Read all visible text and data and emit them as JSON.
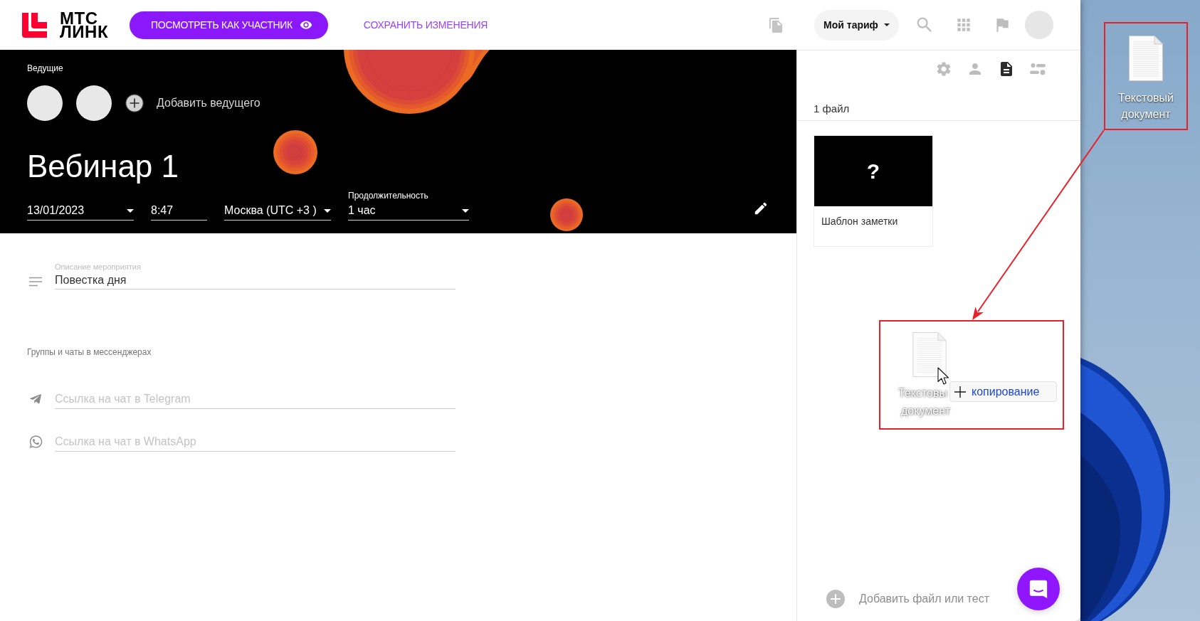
{
  "header": {
    "logo_lines": [
      "МТС",
      "ЛИНК"
    ],
    "preview_button": "ПОСМОТРЕТЬ КАК УЧАСТНИК",
    "save_link": "СОХРАНИТЬ ИЗМЕНЕНИЯ",
    "plan_button": "Мой тариф"
  },
  "banner": {
    "hosts_label": "Ведущие",
    "add_host": "Добавить ведущего",
    "title": "Вебинар 1",
    "schedule_fields": [
      {
        "kind": "dropdown",
        "value": "13/01/2023"
      },
      {
        "kind": "text",
        "value": "8:47"
      },
      {
        "kind": "dropdown",
        "value": "Москва (UTC +3 )"
      },
      {
        "kind": "dropdown",
        "label": "Продолжительность",
        "value": "1 час"
      }
    ]
  },
  "details": {
    "description": {
      "label": "Описание мероприятия",
      "value": "Повестка дня"
    },
    "messengers_heading": "Группы и чаты в мессенджерах",
    "messenger_fields": [
      {
        "kind": "telegram",
        "placeholder": "Ссылка на чат в Telegram"
      },
      {
        "kind": "whatsapp",
        "placeholder": "Ссылка на чат в WhatsApp"
      }
    ]
  },
  "side_panel": {
    "tabs": [
      {
        "kind": "settings",
        "selected": false
      },
      {
        "kind": "people",
        "selected": false
      },
      {
        "kind": "files",
        "selected": true
      },
      {
        "kind": "options",
        "selected": false
      }
    ],
    "file_count": "1 файл",
    "files": [
      {
        "preview": "?",
        "name": "Шаблон заметки"
      }
    ],
    "add_file": "Добавить файл или тест"
  },
  "drag_preview": {
    "highlighted": true,
    "label_lines": [
      "Текстовы",
      "документ"
    ],
    "tooltip": "копирование"
  },
  "desktop": {
    "icons": [
      {
        "label": "Текстовый документ",
        "highlighted": true
      }
    ]
  }
}
